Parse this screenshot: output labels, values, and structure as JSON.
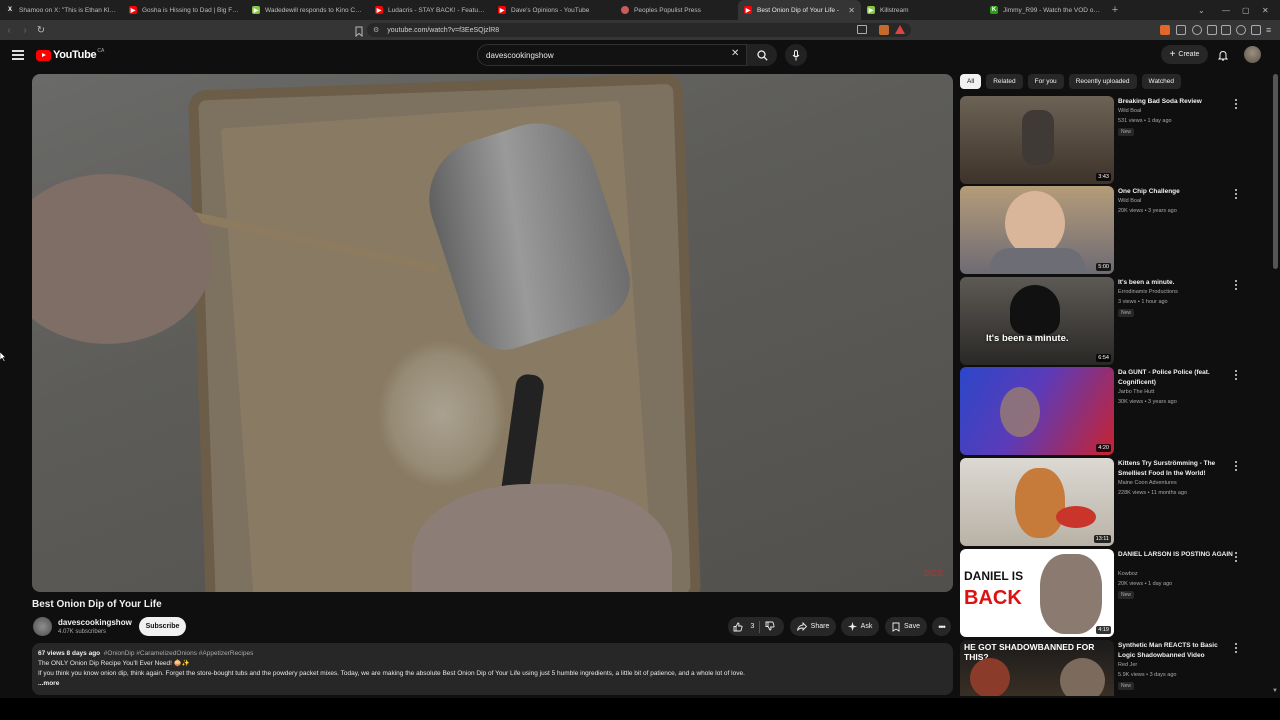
{
  "browser": {
    "tabs": [
      {
        "label": "Shamoo on X: \"This is Ethan Klein ab",
        "favicon": "x-icon",
        "color": "#222222"
      },
      {
        "label": "Gosha is Hissing to Dad | Big Floppa",
        "favicon": "youtube-icon",
        "color": "#ff0000"
      },
      {
        "label": "Wadedewill responds to Kino Casino",
        "favicon": "rumble-icon",
        "color": "#85c742"
      },
      {
        "label": "Ludacris - STAY BACK! - Featuring Ar",
        "favicon": "youtube-icon",
        "color": "#ff0000"
      },
      {
        "label": "Dave's Opinions - YouTube",
        "favicon": "youtube-icon",
        "color": "#ff0000"
      },
      {
        "label": "Peoples Populist Press",
        "favicon": "globe-icon",
        "color": "#c95b5b"
      },
      {
        "label": "Best Onion Dip of Your Life -",
        "favicon": "youtube-icon",
        "color": "#ff0000",
        "active": true
      },
      {
        "label": "Killstream",
        "favicon": "rumble-icon",
        "color": "#85c742"
      },
      {
        "label": "Jimmy_R99 - Watch the VOD on Kick",
        "favicon": "kick-icon",
        "color": "#53fc18"
      }
    ],
    "url": "youtube.com/watch?v=f3EeSQjzlR8"
  },
  "header": {
    "logo_text": "YouTube",
    "country": "CA",
    "search_value": "davescookingshow",
    "create_label": "Create"
  },
  "video": {
    "title": "Best Onion Dip of Your Life",
    "watermark": "DCS",
    "channel_name": "davescookingshow",
    "subscribers": "4.07K subscribers",
    "subscribe_label": "Subscribe",
    "like_count": "3",
    "share_label": "Share",
    "ask_label": "Ask",
    "save_label": "Save"
  },
  "description": {
    "meta": "67 views  8 days ago",
    "tags": "#OnionDip #CaramelizedOnions #AppetizerRecipes",
    "line1": "The ONLY Onion Dip Recipe You'll Ever Need! 🧅✨",
    "line2": "If you think you know onion dip, think again. Forget the store-bought tubs and the powdery packet mixes. Today, we are making the absolute Best Onion Dip of Your Life using just 5 humble ingredients, a little bit of patience, and a whole lot of love.",
    "more": "...more"
  },
  "chips": [
    "All",
    "Related",
    "For you",
    "Recently uploaded",
    "Watched"
  ],
  "recommendations": [
    {
      "title": "Breaking Bad Soda Review",
      "channel": "Wild Boal",
      "meta": "531 views • 1 day ago",
      "badge": "New",
      "duration": "3:43",
      "thumb_colors": [
        "#6c6255",
        "#3d332a"
      ]
    },
    {
      "title": "One Chip Challenge",
      "channel": "Wild Boal",
      "meta": "20K views • 3 years ago",
      "badge": "",
      "duration": "5:00",
      "thumb_colors": [
        "#b59c79",
        "#6e6b74"
      ]
    },
    {
      "title": "It's been a minute.",
      "channel": "Errodinamix Productions",
      "meta": "3 views • 1 hour ago",
      "badge": "New",
      "duration": "6:54",
      "thumb_text": "It's been a minute.",
      "thumb_colors": [
        "#5d5a55",
        "#2a2826"
      ]
    },
    {
      "title": "Da GUNT - Police Police (feat. Cognificent)",
      "channel": "Jarbo The Hutt",
      "meta": "30K views • 3 years ago",
      "badge": "",
      "duration": "4:20",
      "thumb_colors": [
        "#2b47c9",
        "#c8222f"
      ]
    },
    {
      "title": "Kittens Try Surströmming - The Smelliest Food In the World!",
      "channel": "Maine Coon Adventures",
      "meta": "228K views • 11 months ago",
      "badge": "",
      "duration": "13:11",
      "thumb_colors": [
        "#dcd9d3",
        "#c77b3a"
      ]
    },
    {
      "title": "DANIEL LARSON IS POSTING AGAIN",
      "channel": "Kowboz",
      "meta": "20K views • 1 day ago",
      "badge": "New",
      "duration": "4:19",
      "thumb_text": "DANIEL IS",
      "thumb_text2": "BACK",
      "thumb_colors": [
        "#ffffff",
        "#8a8a8a"
      ]
    },
    {
      "title": "Synthetic Man REACTS to Basic Logic Shadowbanned Video",
      "channel": "Red Jer",
      "meta": "5.9K views • 3 days ago",
      "badge": "New",
      "duration": "",
      "thumb_text": "HE GOT SHADOWBANNED FOR THIS?",
      "thumb_colors": [
        "#1b1b1b",
        "#4a3a2a"
      ]
    }
  ]
}
